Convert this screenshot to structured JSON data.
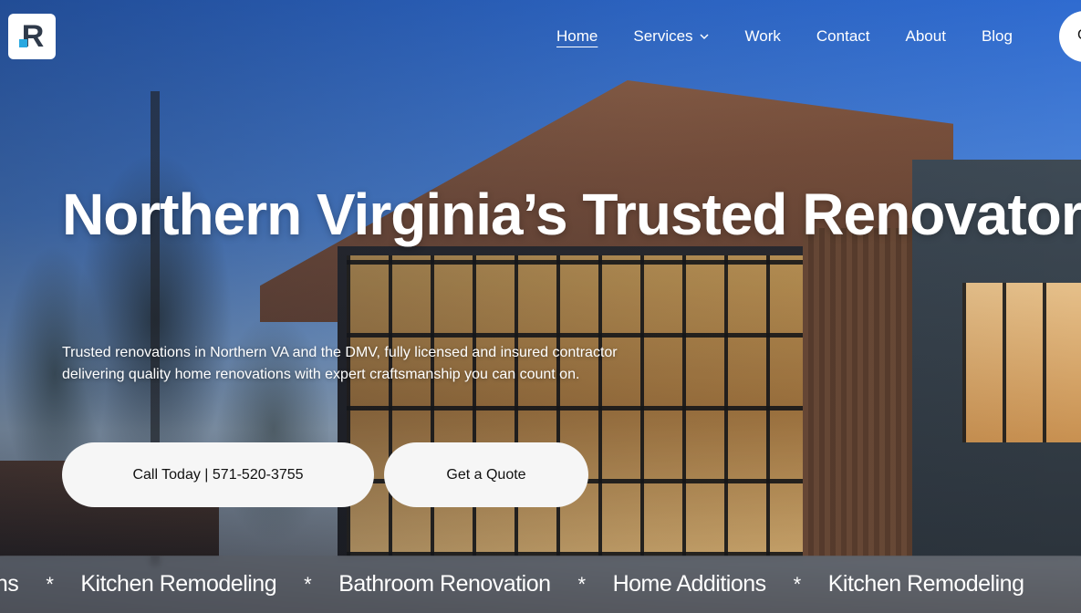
{
  "header": {
    "logo_text": "R",
    "nav": {
      "home": "Home",
      "services": "Services",
      "work": "Work",
      "contact": "Contact",
      "about": "About",
      "blog": "Blog"
    },
    "cta_partial": "C"
  },
  "hero": {
    "title": "Northern Virginia’s Trusted Renovator",
    "subtitle_line1": "Trusted renovations in Northern VA and the DMV, fully licensed and insured contractor",
    "subtitle_line2": "delivering quality home renovations with expert craftsmanship you can count on.",
    "buttons": {
      "call": "Call Today | 571-520-3755",
      "quote": "Get a Quote"
    }
  },
  "marquee": {
    "items": [
      "tions",
      "Kitchen Remodeling",
      "Bathroom Renovation",
      "Home Additions",
      "Kitchen Remodeling"
    ],
    "separator": "*"
  },
  "colors": {
    "accent": "#29a8e0",
    "button_bg": "#f6f6f6",
    "text_light": "#ffffff"
  },
  "icons": {
    "services_dropdown": "chevron-down-icon"
  }
}
